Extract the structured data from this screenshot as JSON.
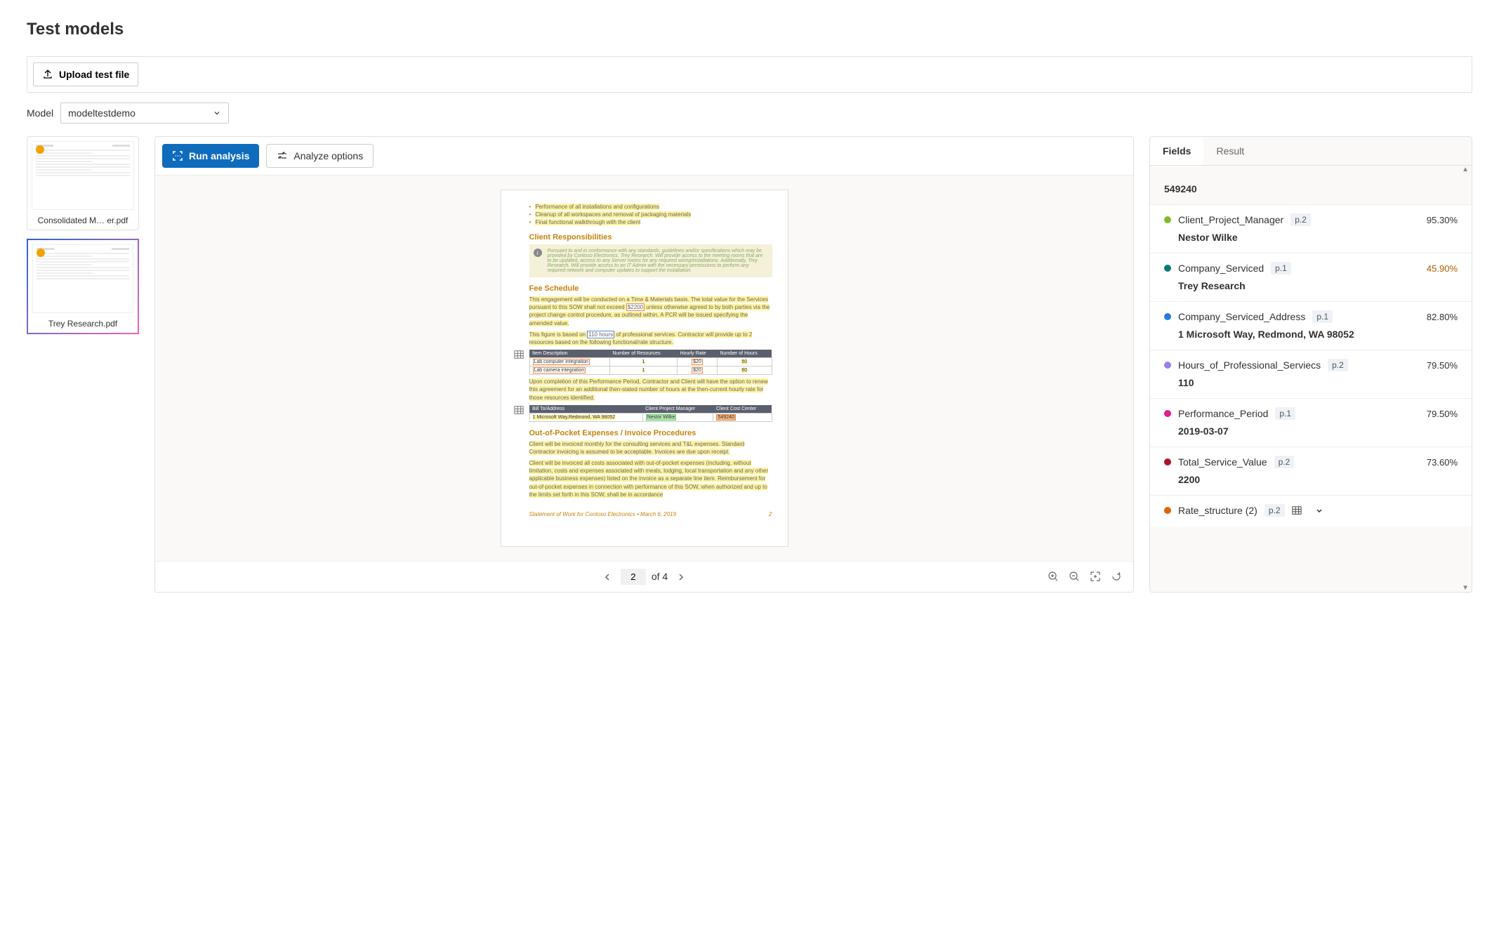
{
  "page_title": "Test models",
  "upload": {
    "label": "Upload test file"
  },
  "model": {
    "label": "Model",
    "selected": "modeltestdemo"
  },
  "thumbnails": [
    {
      "name": "Consolidated M… er.pdf",
      "selected": false
    },
    {
      "name": "Trey Research.pdf",
      "selected": true
    }
  ],
  "actions": {
    "run_analysis": "Run analysis",
    "analyze_options": "Analyze options"
  },
  "pagination": {
    "current": "2",
    "of_label": "of 4"
  },
  "tabs": {
    "fields": "Fields",
    "result": "Result",
    "active": "fields"
  },
  "top_value": "549240",
  "fields": [
    {
      "color": "#7dbd2a",
      "name": "Client_Project_Manager",
      "page": "p.2",
      "conf": "95.30%",
      "low": false,
      "value": "Nestor Wilke"
    },
    {
      "color": "#0b7a7a",
      "name": "Company_Serviced",
      "page": "p.1",
      "conf": "45.90%",
      "low": true,
      "value": "Trey Research"
    },
    {
      "color": "#2b78e4",
      "name": "Company_Serviced_Address",
      "page": "p.1",
      "conf": "82.80%",
      "low": false,
      "value": "1 Microsoft Way, Redmond, WA 98052"
    },
    {
      "color": "#9b7ee6",
      "name": "Hours_of_Professional_Serviecs",
      "page": "p.2",
      "conf": "79.50%",
      "low": false,
      "value": "110"
    },
    {
      "color": "#e61a8d",
      "name": "Performance_Period",
      "page": "p.1",
      "conf": "79.50%",
      "low": false,
      "value": "2019-03-07"
    },
    {
      "color": "#b01030",
      "name": "Total_Service_Value",
      "page": "p.2",
      "conf": "73.60%",
      "low": false,
      "value": "2200"
    },
    {
      "color": "#e06400",
      "name": "Rate_structure (2)",
      "page": "p.2",
      "conf": "",
      "low": false,
      "value": "",
      "table": true
    }
  ],
  "doc": {
    "bullets": [
      "Performance of all installations and configurations",
      "Cleanup of all workspaces and removal of packaging materials",
      "Final functional walkthrough with the client"
    ],
    "sec1": "Client Responsibilities",
    "note": "Pursuant to and in conformance with any standards, guidelines and/or specifications which may be provided by Contoso Electronics. Trey Research. Will provide access to the meeting rooms that are to be updated, access to any Server rooms for any required wiring/installations. Additionally, Trey Research. Will provide access to an IT Admin with the necessary permissions to perform any required network and computer updates to support the installation.",
    "sec2": "Fee Schedule",
    "p1a": "This engagement will be conducted on a Time & Materials basis. The total value for the Services pursuant to this SOW shall not exceed ",
    "p1_val": "$2200",
    "p1b": " unless otherwise agreed to by both parties via the project change control procedure, as outlined within. A PCR will be issued specifying the amended value.",
    "p2a": "This figure is based on ",
    "p2_val": "110 hours",
    "p2b": " of professional services. Contractor will provide up to 2 resources based on the following functional/rate structure.",
    "t1h": [
      "Item Description",
      "Number of Resources",
      "Hourly Rate",
      "Number of Hours"
    ],
    "t1r": [
      [
        "Lab computer integration",
        "1",
        "$20",
        "50"
      ],
      [
        "Lab camera integration",
        "1",
        "$20",
        "60"
      ]
    ],
    "p3": "Upon completion of this Performance Period, Contractor and Client will have the option to renew this agreement for an additional then-stated number of hours at the then-current hourly rate for those resources identified.",
    "t2h": [
      "Bill To/Address",
      "Client Project Manager",
      "Client Cost Center"
    ],
    "t2r": [
      "1 Microsoft Way,Redmond, WA 98052",
      "Nestor Wilke",
      "549240"
    ],
    "sec3": "Out-of-Pocket Expenses / Invoice Procedures",
    "p4": "Client will be invoiced monthly for the consulting services and T&L expenses. Standard Contractor invoicing is assumed to be acceptable. Invoices are due upon receipt.",
    "p5": "Client will be invoiced all costs associated with out-of-pocket expenses (including, without limitation, costs and expenses associated with meals, lodging, local transportation and any other applicable business expenses) listed on the invoice as a separate line item. Reimbursement for out-of-pocket expenses in connection with performance of this SOW, when authorized and up to the limits set forth in this SOW, shall be in accordance",
    "footer_left": "Statement of Work for Contoso Electronics • March 6, 2019",
    "footer_right": "2"
  }
}
